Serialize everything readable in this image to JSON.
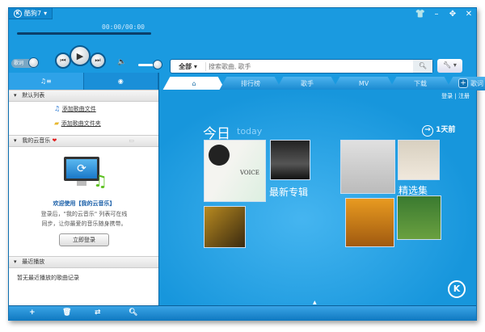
{
  "app": {
    "title": "酷狗7",
    "time": "00:00/00:00",
    "lyrics_label": "歌词"
  },
  "window_controls": [
    "skin",
    "minimize",
    "mini-mode",
    "close"
  ],
  "search": {
    "category": "全部",
    "placeholder": "搜索歌曲, 歌手"
  },
  "tabs": [
    {
      "label": "",
      "icon": "home-icon"
    },
    {
      "label": "排行榜"
    },
    {
      "label": "歌手"
    },
    {
      "label": "MV"
    },
    {
      "label": "下载"
    },
    {
      "label": "歌词"
    }
  ],
  "account": {
    "login": "登录",
    "separator": "|",
    "register": "注册"
  },
  "sidebar": {
    "default_list": {
      "title": "默认列表",
      "add_file": "添加歌曲文件",
      "add_folder": "添加歌曲文件夹"
    },
    "cloud": {
      "title": "我的云音乐",
      "welcome": "欢迎使用【我的云音乐】",
      "desc1": "登录后，\"我的云音乐\" 列表可在线",
      "desc2": "同步，让你最爱的音乐随身携带。",
      "login_button": "立即登录"
    },
    "recent": {
      "title": "最近播放",
      "empty": "暂无最近播放的歌曲记录"
    }
  },
  "content": {
    "today": "今日",
    "today_en": "today",
    "prev": "1天前",
    "new_albums": "最新专辑",
    "featured": "精选集",
    "album_text": "VOICE"
  }
}
